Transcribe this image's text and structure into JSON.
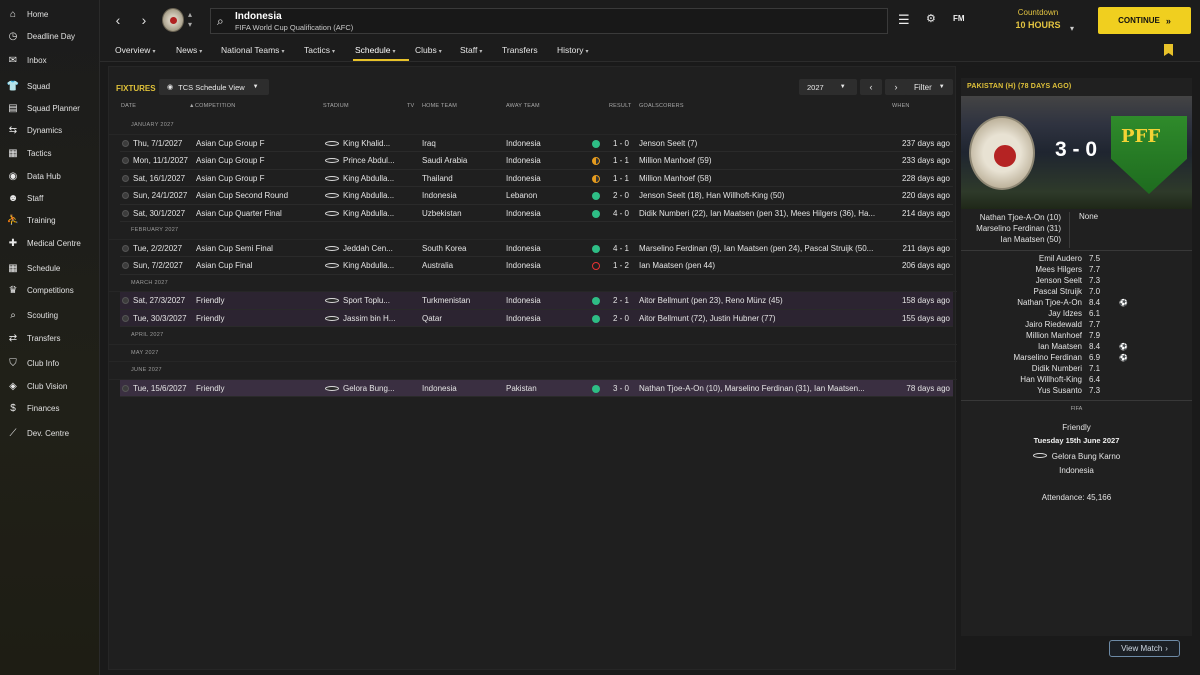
{
  "sidebar": {
    "items": [
      {
        "label": "Home",
        "icon": "home-icon",
        "glyph": "⌂"
      },
      {
        "label": "Deadline Day",
        "icon": "clock-icon",
        "glyph": "◷"
      },
      {
        "label": "Inbox",
        "icon": "inbox-icon",
        "glyph": "✉"
      },
      {
        "label": "Squad",
        "icon": "shirt-icon",
        "glyph": "👕"
      },
      {
        "label": "Squad Planner",
        "icon": "planner-icon",
        "glyph": "▤"
      },
      {
        "label": "Dynamics",
        "icon": "dynamics-icon",
        "glyph": "⇆"
      },
      {
        "label": "Tactics",
        "icon": "tactics-icon",
        "glyph": "▦"
      },
      {
        "label": "Data Hub",
        "icon": "data-hub-icon",
        "glyph": "◉"
      },
      {
        "label": "Staff",
        "icon": "staff-icon",
        "glyph": "☻"
      },
      {
        "label": "Training",
        "icon": "training-icon",
        "glyph": "⛹"
      },
      {
        "label": "Medical Centre",
        "icon": "medical-icon",
        "glyph": "✚"
      },
      {
        "label": "Schedule",
        "icon": "calendar-icon",
        "glyph": "▦"
      },
      {
        "label": "Competitions",
        "icon": "trophy-icon",
        "glyph": "♛"
      },
      {
        "label": "Scouting",
        "icon": "scouting-icon",
        "glyph": "⌕"
      },
      {
        "label": "Transfers",
        "icon": "transfers-icon",
        "glyph": "⇄"
      },
      {
        "label": "Club Info",
        "icon": "shield-icon",
        "glyph": "⛉"
      },
      {
        "label": "Club Vision",
        "icon": "vision-icon",
        "glyph": "◈"
      },
      {
        "label": "Finances",
        "icon": "finances-icon",
        "glyph": "$"
      },
      {
        "label": "Dev. Centre",
        "icon": "dev-centre-icon",
        "glyph": "⟋"
      }
    ]
  },
  "header": {
    "title": "Indonesia",
    "subtitle": "FIFA World Cup Qualification (AFC)",
    "logo": "FM",
    "countdown_label": "Countdown",
    "countdown_value": "10 HOURS",
    "continue_label": "CONTINUE"
  },
  "subnav": [
    {
      "label": "Overview",
      "caret": true
    },
    {
      "label": "News",
      "caret": true
    },
    {
      "label": "National Teams",
      "caret": true
    },
    {
      "label": "Tactics",
      "caret": true
    },
    {
      "label": "Schedule",
      "caret": true,
      "active": true
    },
    {
      "label": "Clubs",
      "caret": true
    },
    {
      "label": "Staff",
      "caret": true
    },
    {
      "label": "Transfers",
      "caret": false
    },
    {
      "label": "History",
      "caret": true
    }
  ],
  "fixtures": {
    "label": "FIXTURES",
    "view_label": "TCS Schedule View",
    "year": "2027",
    "filter_label": "Filter",
    "columns": {
      "date": "DATE",
      "competition": "COMPETITION",
      "stadium": "STADIUM",
      "tv": "TV",
      "home": "HOME TEAM",
      "away": "AWAY TEAM",
      "result": "RESULT",
      "scorers": "GOALSCORERS",
      "when": "WHEN"
    },
    "groups": [
      {
        "month": "JANUARY 2027",
        "rows": [
          {
            "date": "Thu, 7/1/2027",
            "competition": "Asian Cup Group F",
            "stadium": "King Khalid...",
            "home": "Iraq",
            "away": "Indonesia",
            "outcome": "win",
            "score": "1 - 0",
            "scorers": "Jenson Seelt (7)",
            "when": "237 days ago"
          },
          {
            "date": "Mon, 11/1/2027",
            "competition": "Asian Cup Group F",
            "stadium": "Prince Abdul...",
            "home": "Saudi Arabia",
            "away": "Indonesia",
            "outcome": "draw",
            "score": "1 - 1",
            "scorers": "Million Manhoef (59)",
            "when": "233 days ago"
          },
          {
            "date": "Sat, 16/1/2027",
            "competition": "Asian Cup Group F",
            "stadium": "King Abdulla...",
            "home": "Thailand",
            "away": "Indonesia",
            "outcome": "draw",
            "score": "1 - 1",
            "scorers": "Million Manhoef (58)",
            "when": "228 days ago"
          },
          {
            "date": "Sun, 24/1/2027",
            "competition": "Asian Cup Second Round",
            "stadium": "King Abdulla...",
            "home": "Indonesia",
            "away": "Lebanon",
            "outcome": "win",
            "score": "2 - 0",
            "scorers": "Jenson Seelt (18), Han Willhoft-King (50)",
            "when": "220 days ago"
          },
          {
            "date": "Sat, 30/1/2027",
            "competition": "Asian Cup Quarter Final",
            "stadium": "King Abdulla...",
            "home": "Uzbekistan",
            "away": "Indonesia",
            "outcome": "win",
            "score": "4 - 0",
            "scorers": "Didik Numberi (22), Ian Maatsen (pen 31), Mees Hilgers (36), Ha...",
            "when": "214 days ago"
          }
        ]
      },
      {
        "month": "FEBRUARY 2027",
        "rows": [
          {
            "date": "Tue, 2/2/2027",
            "competition": "Asian Cup Semi Final",
            "stadium": "Jeddah Cen...",
            "home": "South Korea",
            "away": "Indonesia",
            "outcome": "win",
            "score": "4 - 1",
            "scorers": "Marselino Ferdinan (9), Ian Maatsen (pen 24), Pascal Struijk (50...",
            "when": "211 days ago"
          },
          {
            "date": "Sun, 7/2/2027",
            "competition": "Asian Cup Final",
            "stadium": "King Abdulla...",
            "home": "Australia",
            "away": "Indonesia",
            "outcome": "loss",
            "score": "1 - 2",
            "scorers": "Ian Maatsen (pen 44)",
            "when": "206 days ago"
          }
        ]
      },
      {
        "month": "MARCH 2027",
        "rows": [
          {
            "date": "Sat, 27/3/2027",
            "competition": "Friendly",
            "stadium": "Sport Toplu...",
            "home": "Turkmenistan",
            "away": "Indonesia",
            "outcome": "win",
            "score": "2 - 1",
            "scorers": "Aitor Bellmunt (pen 23), Reno Münz (45)",
            "when": "158 days ago",
            "friendly": true
          },
          {
            "date": "Tue, 30/3/2027",
            "competition": "Friendly",
            "stadium": "Jassim bin H...",
            "home": "Qatar",
            "away": "Indonesia",
            "outcome": "win",
            "score": "2 - 0",
            "scorers": "Aitor Bellmunt (72), Justin Hubner (77)",
            "when": "155 days ago",
            "friendly": true
          }
        ]
      },
      {
        "month": "APRIL 2027",
        "rows": []
      },
      {
        "month": "MAY 2027",
        "rows": []
      },
      {
        "month": "JUNE 2027",
        "rows": [
          {
            "date": "Tue, 15/6/2027",
            "competition": "Friendly",
            "stadium": "Gelora Bung...",
            "home": "Indonesia",
            "away": "Pakistan",
            "outcome": "win",
            "score": "3 - 0",
            "scorers": "Nathan Tjoe-A-On (10), Marselino Ferdinan (31), Ian Maatsen...",
            "when": "78 days ago",
            "friendly": true,
            "selected": true
          }
        ]
      }
    ]
  },
  "match": {
    "header": "PAKISTAN (H) (78 DAYS AGO)",
    "score": "3 - 0",
    "away_crest_text": "PFF",
    "home_scorers": [
      "Nathan Tjoe-A-On (10)",
      "Marselino Ferdinan (31)",
      "Ian Maatsen (50)"
    ],
    "away_scorers": "None",
    "ratings": [
      {
        "name": "Emil Audero",
        "rating": "7.5",
        "goal": false
      },
      {
        "name": "Mees Hilgers",
        "rating": "7.7",
        "goal": false
      },
      {
        "name": "Jenson Seelt",
        "rating": "7.3",
        "goal": false
      },
      {
        "name": "Pascal Struijk",
        "rating": "7.0",
        "goal": false
      },
      {
        "name": "Nathan Tjoe-A-On",
        "rating": "8.4",
        "goal": true
      },
      {
        "name": "Jay Idzes",
        "rating": "6.1",
        "goal": false
      },
      {
        "name": "Jairo Riedewald",
        "rating": "7.7",
        "goal": false
      },
      {
        "name": "Million Manhoef",
        "rating": "7.9",
        "goal": false
      },
      {
        "name": "Ian Maatsen",
        "rating": "8.4",
        "goal": true
      },
      {
        "name": "Marselino Ferdinan",
        "rating": "6.9",
        "goal": true
      },
      {
        "name": "Didik Numberi",
        "rating": "7.1",
        "goal": false
      },
      {
        "name": "Han Willhoft-King",
        "rating": "6.4",
        "goal": false
      },
      {
        "name": "Yus Susanto",
        "rating": "7.3",
        "goal": false
      }
    ],
    "federation": "FIFA",
    "competition": "Friendly",
    "date": "Tuesday 15th June 2027",
    "stadium": "Gelora Bung Karno",
    "country": "Indonesia",
    "attendance": "Attendance: 45,166",
    "view_match_label": "View Match"
  },
  "colors": {
    "accent": "#e8c22a",
    "win": "#2ebd85",
    "draw": "#e59b1e",
    "loss": "#e63333",
    "friendly_row": "#2c2431"
  }
}
